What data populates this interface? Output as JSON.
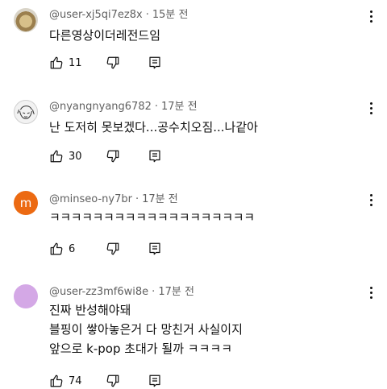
{
  "comments": [
    {
      "avatar": "food-photo-avatar",
      "username": "@user-xj5qi7ez8x",
      "time": "15분 전",
      "lines": [
        "다른영상이더레전드임"
      ],
      "likes": "11"
    },
    {
      "avatar": "manga-drawing-avatar",
      "username": "@nyangnyang6782",
      "time": "17분 전",
      "lines": [
        "난 도저히 못보겠다...공수치오짐...나같아"
      ],
      "likes": "30"
    },
    {
      "avatar": "letter-avatar",
      "avatar_letter": "m",
      "avatar_color": "#ec6a12",
      "username": "@minseo-ny7br",
      "time": "17분 전",
      "lines": [
        "ㅋㅋㅋㅋㅋㅋㅋㅋㅋㅋㅋㅋㅋㅋㅋㅋㅋㅋㅋ"
      ],
      "likes": "6"
    },
    {
      "avatar": "plain-avatar",
      "avatar_color": "#d4a8e6",
      "username": "@user-zz3mf6wi8e",
      "time": "17분 전",
      "lines": [
        "진짜 반성해야돼",
        "블핑이 쌓아놓은거 다 망친거 사실이지",
        "앞으로 k-pop 초대가 될까 ㅋㅋㅋㅋ"
      ],
      "likes": "74"
    }
  ],
  "icons": {
    "like": "thumbs-up-icon",
    "dislike": "thumbs-down-icon",
    "reply": "reply-comment-icon",
    "menu": "more-vert-icon"
  },
  "colors": {
    "text": "#0f0f0f",
    "meta": "#606060",
    "background": "#ffffff"
  }
}
